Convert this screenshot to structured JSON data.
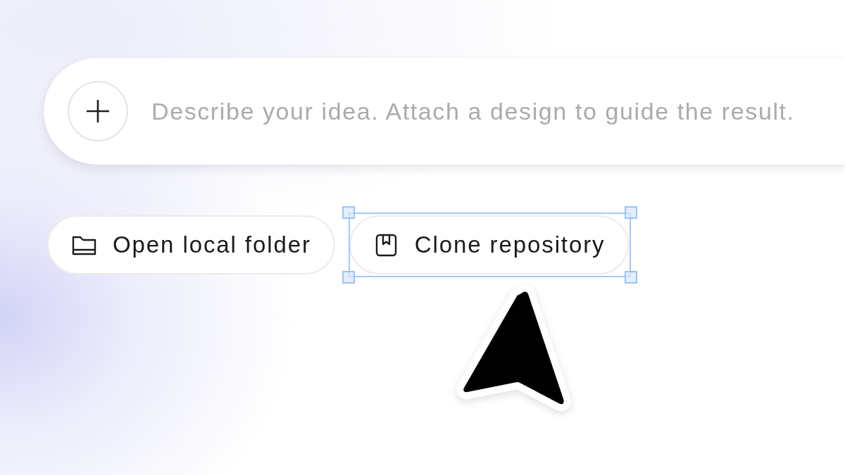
{
  "prompt": {
    "placeholder": "Describe your idea. Attach a design to guide the result."
  },
  "buttons": [
    {
      "kind": "folder",
      "label": "Open local folder",
      "selected": false
    },
    {
      "kind": "repository",
      "label": "Clone repository",
      "selected": true
    }
  ]
}
